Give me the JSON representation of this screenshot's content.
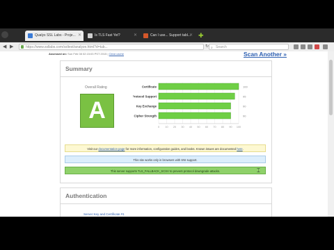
{
  "tabs": [
    {
      "title": "Qualys SSL Labs - Proje...",
      "active": true,
      "icon_color": "#3b7bd6",
      "icon": "ssllabs-icon"
    },
    {
      "title": "Is TLS Fast Yet?",
      "active": false,
      "icon_color": "#cfcfcf",
      "icon": "page-icon"
    },
    {
      "title": "Can I use... Support tabl...",
      "active": false,
      "icon_color": "#d4572a",
      "icon": "caniuse-icon"
    }
  ],
  "nav": {
    "url": "https://www.ssllabs.com/ssltest/analyze.html?d=tub...",
    "search_placeholder": "Search",
    "back": "◀",
    "forward": "▶",
    "reload": "↻"
  },
  "page": {
    "assessed_label": "Assessed on:",
    "assessed_value": "Sun Feb 08 02:15:03 PST 2015",
    "clear_cache": "Clear cache",
    "scan_another": "Scan Another »"
  },
  "summary": {
    "title": "Summary",
    "overall_label": "Overall Rating",
    "grade": "A",
    "grade_color": "#7ac143"
  },
  "chart_data": {
    "type": "bar",
    "orientation": "horizontal",
    "categories": [
      "Certificate",
      "Protocol Support",
      "Key Exchange",
      "Cipher Strength"
    ],
    "values": [
      100,
      95,
      90,
      90
    ],
    "xticks": [
      0,
      10,
      20,
      30,
      40,
      50,
      60,
      70,
      80,
      90,
      100
    ],
    "xlim": [
      0,
      100
    ],
    "bar_color": "#6fcf45"
  },
  "notes": {
    "doc_prefix": "Visit our",
    "doc_link": "documentation page",
    "doc_suffix": "for more information, configuration guides, and books. Known issues are documented",
    "doc_here": "here",
    "sni": "This site works only in browsers with SNI support.",
    "fallback": "This server supports TLS_FALLBACK_SCSV to prevent protocol downgrade attacks."
  },
  "auth": {
    "title": "Authentication",
    "cert_label": "Server Key and Certificate #1"
  }
}
